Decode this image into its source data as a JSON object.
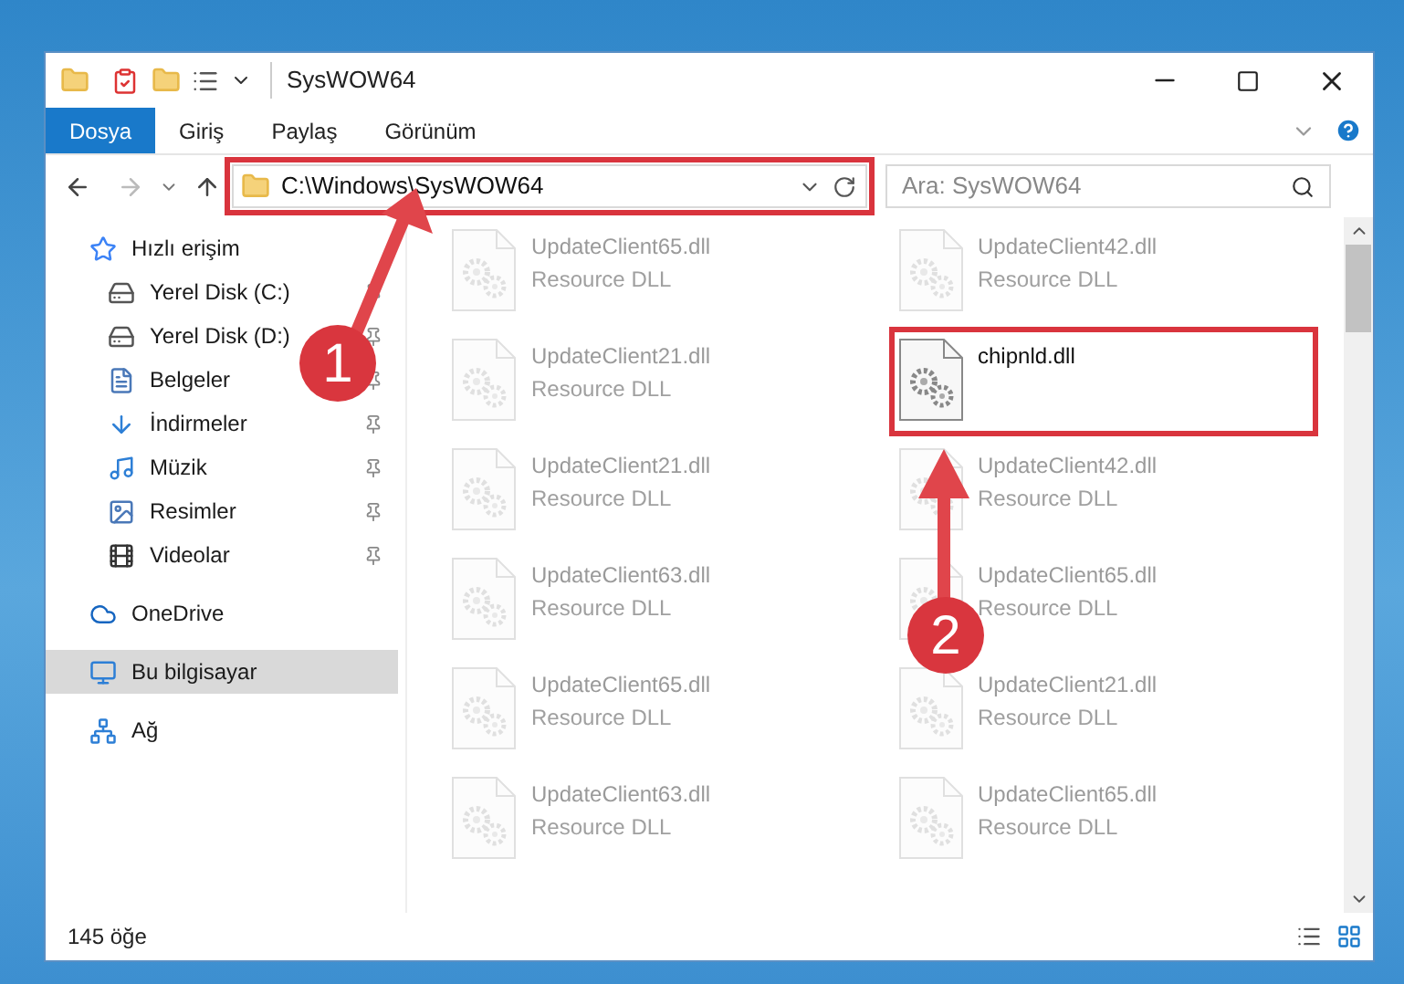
{
  "window": {
    "title": "SysWOW64"
  },
  "ribbon_tabs": [
    {
      "label": "Dosya",
      "selected": true
    },
    {
      "label": "Giriş",
      "selected": false
    },
    {
      "label": "Paylaş",
      "selected": false
    },
    {
      "label": "Görünüm",
      "selected": false
    }
  ],
  "address": {
    "path": "C:\\Windows\\SysWOW64",
    "highlighted": true
  },
  "search": {
    "placeholder": "Ara: SysWOW64"
  },
  "sidebar": {
    "items": [
      {
        "kind": "star",
        "label": "Hızlı erişim",
        "pinned": false,
        "selected": false,
        "children": [
          {
            "kind": "drive",
            "label": "Yerel Disk (C:)",
            "pinned": true,
            "selected": false
          },
          {
            "kind": "drive",
            "label": "Yerel Disk (D:)",
            "pinned": true,
            "selected": false
          },
          {
            "kind": "docs",
            "label": "Belgeler",
            "pinned": true,
            "selected": false
          },
          {
            "kind": "download",
            "label": "İndirmeler",
            "pinned": true,
            "selected": false
          },
          {
            "kind": "music",
            "label": "Müzik",
            "pinned": true,
            "selected": false
          },
          {
            "kind": "pictures",
            "label": "Resimler",
            "pinned": true,
            "selected": false
          },
          {
            "kind": "video",
            "label": "Videolar",
            "pinned": true,
            "selected": false
          }
        ]
      },
      {
        "kind": "cloud",
        "label": "OneDrive",
        "pinned": false,
        "selected": false
      },
      {
        "kind": "pc",
        "label": "Bu bilgisayar",
        "pinned": false,
        "selected": true
      },
      {
        "kind": "network",
        "label": "Ağ",
        "pinned": false,
        "selected": false
      }
    ]
  },
  "files": [
    {
      "name": "UpdateClient65.dll",
      "type": "Resource DLL",
      "faded": true
    },
    {
      "name": "UpdateClient42.dll",
      "type": "Resource DLL",
      "faded": true
    },
    {
      "name": "UpdateClient21.dll",
      "type": "Resource DLL",
      "faded": true
    },
    {
      "name": "chipnld.dll",
      "faded": false,
      "highlighted": true
    },
    {
      "name": "UpdateClient21.dll",
      "type": "Resource DLL",
      "faded": true
    },
    {
      "name": "UpdateClient42.dll",
      "type": "Resource DLL",
      "faded": true
    },
    {
      "name": "UpdateClient63.dll",
      "type": "Resource DLL",
      "faded": true
    },
    {
      "name": "UpdateClient65.dll",
      "type": "Resource DLL",
      "faded": true
    },
    {
      "name": "UpdateClient65.dll",
      "type": "Resource DLL",
      "faded": true
    },
    {
      "name": "UpdateClient21.dll",
      "type": "Resource DLL",
      "faded": true
    },
    {
      "name": "UpdateClient63.dll",
      "type": "Resource DLL",
      "faded": true
    },
    {
      "name": "UpdateClient65.dll",
      "type": "Resource DLL",
      "faded": true
    }
  ],
  "status_bar": {
    "count": "145 öğe"
  },
  "annotations": [
    {
      "number": "1"
    },
    {
      "number": "2"
    }
  ]
}
